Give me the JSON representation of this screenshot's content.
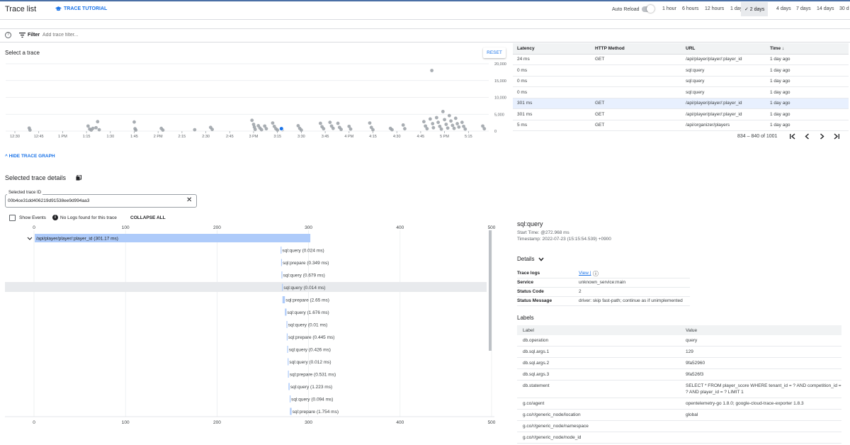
{
  "header": {
    "title": "Trace list",
    "tutorial_label": "TRACE TUTORIAL",
    "auto_reload_label": "Auto Reload",
    "time_ranges": [
      "1 hour",
      "6 hours",
      "12 hours",
      "1 day",
      "2 days",
      "4 days",
      "7 days",
      "14 days",
      "30 d"
    ],
    "selected_range": "2 days"
  },
  "filter": {
    "label": "Filter",
    "placeholder": "Add trace filter..."
  },
  "scatter": {
    "title": "Select a trace",
    "reset_label": "RESET"
  },
  "chart_data": {
    "type": "scatter",
    "x_ticks": [
      "12:30",
      "12:45",
      "1 PM",
      "1:15",
      "1:30",
      "1:45",
      "2 PM",
      "2:15",
      "2:30",
      "2:45",
      "3 PM",
      "3:15",
      "3:30",
      "3:45",
      "4 PM",
      "4:15",
      "4:30",
      "4:45",
      "5 PM",
      "5:15"
    ],
    "y_ticks": [
      "0",
      "5,000",
      "10,000",
      "15,000",
      "20,000"
    ],
    "ylim": [
      0,
      20000
    ],
    "x_start_label": "12:30",
    "minutes_per_tick": 15,
    "points": [
      {
        "t": 9,
        "y": 900
      },
      {
        "t": 9.5,
        "y": 300
      },
      {
        "t": 46,
        "y": 1500
      },
      {
        "t": 47,
        "y": 600
      },
      {
        "t": 48,
        "y": 300
      },
      {
        "t": 49,
        "y": 800
      },
      {
        "t": 52,
        "y": 2800
      },
      {
        "t": 53,
        "y": 400
      },
      {
        "t": 51,
        "y": 1000
      },
      {
        "t": 75,
        "y": 2700
      },
      {
        "t": 75.5,
        "y": 700
      },
      {
        "t": 76,
        "y": 300
      },
      {
        "t": 92,
        "y": 800
      },
      {
        "t": 93,
        "y": 300
      },
      {
        "t": 113,
        "y": 400
      },
      {
        "t": 123,
        "y": 1100
      },
      {
        "t": 124,
        "y": 500
      },
      {
        "t": 149,
        "y": 3200
      },
      {
        "t": 150,
        "y": 2000
      },
      {
        "t": 150.5,
        "y": 1200
      },
      {
        "t": 151,
        "y": 500
      },
      {
        "t": 153,
        "y": 1600
      },
      {
        "t": 154,
        "y": 900
      },
      {
        "t": 155,
        "y": 400
      },
      {
        "t": 157,
        "y": 1500
      },
      {
        "t": 158,
        "y": 700
      },
      {
        "t": 162,
        "y": 2400
      },
      {
        "t": 163,
        "y": 1400
      },
      {
        "t": 164,
        "y": 700
      },
      {
        "t": 165,
        "y": 300
      },
      {
        "t": 168,
        "y": 400
      },
      {
        "t": 178,
        "y": 1600
      },
      {
        "t": 179,
        "y": 800
      },
      {
        "t": 180,
        "y": 300
      },
      {
        "t": 192,
        "y": 2300
      },
      {
        "t": 193,
        "y": 1300
      },
      {
        "t": 194,
        "y": 700
      },
      {
        "t": 198,
        "y": 2600
      },
      {
        "t": 199,
        "y": 1500
      },
      {
        "t": 200,
        "y": 800
      },
      {
        "t": 203,
        "y": 2300
      },
      {
        "t": 204,
        "y": 1100
      },
      {
        "t": 205,
        "y": 500
      },
      {
        "t": 210,
        "y": 1400
      },
      {
        "t": 211,
        "y": 600
      },
      {
        "t": 223,
        "y": 2400
      },
      {
        "t": 224,
        "y": 1100
      },
      {
        "t": 225,
        "y": 400
      },
      {
        "t": 236,
        "y": 800
      },
      {
        "t": 237,
        "y": 400
      },
      {
        "t": 244,
        "y": 1800
      },
      {
        "t": 245,
        "y": 700
      },
      {
        "t": 262,
        "y": 18000
      },
      {
        "t": 257,
        "y": 2800
      },
      {
        "t": 258,
        "y": 1500
      },
      {
        "t": 259,
        "y": 700
      },
      {
        "t": 261,
        "y": 3600
      },
      {
        "t": 262.5,
        "y": 2200
      },
      {
        "t": 263,
        "y": 1000
      },
      {
        "t": 265,
        "y": 4000
      },
      {
        "t": 266,
        "y": 2600
      },
      {
        "t": 267,
        "y": 1400
      },
      {
        "t": 268,
        "y": 600
      },
      {
        "t": 269,
        "y": 5800
      },
      {
        "t": 270,
        "y": 3400
      },
      {
        "t": 271,
        "y": 2000
      },
      {
        "t": 272,
        "y": 900
      },
      {
        "t": 273,
        "y": 4600
      },
      {
        "t": 274,
        "y": 3000
      },
      {
        "t": 275,
        "y": 1700
      },
      {
        "t": 276,
        "y": 800
      },
      {
        "t": 277,
        "y": 3800
      },
      {
        "t": 278,
        "y": 2200
      },
      {
        "t": 279,
        "y": 1200
      },
      {
        "t": 281,
        "y": 2600
      },
      {
        "t": 282,
        "y": 1400
      },
      {
        "t": 283,
        "y": 600
      },
      {
        "t": 294,
        "y": 1500
      },
      {
        "t": 295,
        "y": 700
      }
    ],
    "selected_point": {
      "t": 167.5,
      "y": 301
    }
  },
  "trace_table": {
    "columns": [
      "Latency",
      "HTTP Method",
      "URL",
      "Time"
    ],
    "rows": [
      [
        "24 ms",
        "GET",
        "/api/player/player/:player_id",
        "1 day ago"
      ],
      [
        "0 ms",
        "",
        "sql:query",
        "1 day ago"
      ],
      [
        "0 ms",
        "",
        "sql:query",
        "1 day ago"
      ],
      [
        "0 ms",
        "",
        "sql:query",
        "1 day ago"
      ],
      [
        "301 ms",
        "GET",
        "/api/player/player/:player_id",
        "1 day ago"
      ],
      [
        "301 ms",
        "GET",
        "/api/player/player/:player_id",
        "1 day ago"
      ],
      [
        "5 ms",
        "GET",
        "/api/organizer/players",
        "1 day ago"
      ]
    ],
    "selected_row": 4,
    "sort_arrow": "↓",
    "pager_text": "834 – 840 of 1001"
  },
  "graph": {
    "hide_label": "HIDE TRACE GRAPH"
  },
  "details": {
    "title": "Selected trace details",
    "trace_id_label": "Selected trace ID",
    "trace_id": "00b4ce31dd406219d91538ee9d994aa3",
    "show_events_label": "Show Events",
    "no_logs_label": "No Logs found for this trace",
    "collapse_all_label": "COLLAPSE ALL"
  },
  "waterfall": {
    "axis_max": 500,
    "ticks": [
      "0",
      "100",
      "200",
      "300",
      "400",
      "500"
    ],
    "root": {
      "label": "/api/player/player/:player_id (301.17 ms)",
      "start": 0,
      "duration": 301.17
    },
    "spans": [
      {
        "label": "sql:query (0.024 ms)",
        "start": 269.5,
        "duration": 0.3
      },
      {
        "label": "sql:prepare (0.349 ms)",
        "start": 270.0,
        "duration": 0.5
      },
      {
        "label": "sql:query (0.679 ms)",
        "start": 270.4,
        "duration": 0.7
      },
      {
        "label": "sql:query (0.014 ms)",
        "start": 271.0,
        "duration": 0.3
      },
      {
        "label": "sql:prepare (2.65 ms)",
        "start": 271.5,
        "duration": 2.65
      },
      {
        "label": "sql:query (1.676 ms)",
        "start": 274.2,
        "duration": 1.68
      },
      {
        "label": "sql:query (0.01 ms)",
        "start": 275.9,
        "duration": 0.3
      },
      {
        "label": "sql:prepare (0.445 ms)",
        "start": 276.2,
        "duration": 0.5
      },
      {
        "label": "sql:query (0.426 ms)",
        "start": 276.7,
        "duration": 0.5
      },
      {
        "label": "sql:query (0.012 ms)",
        "start": 277.2,
        "duration": 0.3
      },
      {
        "label": "sql:prepare (0.531 ms)",
        "start": 277.5,
        "duration": 0.53
      },
      {
        "label": "sql:query (1.223 ms)",
        "start": 278.1,
        "duration": 1.22
      },
      {
        "label": "sql:query (0.094 ms)",
        "start": 279.4,
        "duration": 0.3
      },
      {
        "label": "sql:prepare (1.754 ms)",
        "start": 279.7,
        "duration": 1.75
      }
    ],
    "highlighted_span": 3
  },
  "span_detail": {
    "name": "sql:query",
    "start_time": "Start Time: @272.968 ms",
    "timestamp": "Timestamp: 2022-07-23 (15:15:54.539) +0900",
    "details_label": "Details",
    "fields": [
      {
        "key": "Trace logs",
        "value": "View |"
      },
      {
        "key": "Service",
        "value": "unknown_service:main"
      },
      {
        "key": "Status Code",
        "value": "2"
      },
      {
        "key": "Status Message",
        "value": "driver: skip fast-path; continue as if unimplemented"
      }
    ],
    "labels_title": "Labels",
    "labels_columns": [
      "Label",
      "Value"
    ],
    "labels": [
      [
        "db.operation",
        "query"
      ],
      [
        "db.sql.args.1",
        "129"
      ],
      [
        "db.sql.args.2",
        "9fa52960"
      ],
      [
        "db.sql.args.3",
        "9fa526f3"
      ],
      [
        "db.statement",
        "SELECT * FROM player_score WHERE tenant_id = ? AND competition_id = ? AND player_id = ? LIMIT 1"
      ],
      [
        "g.co/agent",
        "opentelemetry-go 1.8.0; google-cloud-trace-exporter 1.8.3"
      ],
      [
        "g.co/r/generic_node/location",
        "global"
      ],
      [
        "g.co/r/generic_node/namespace",
        ""
      ],
      [
        "g.co/r/generic_node/node_id",
        ""
      ]
    ]
  },
  "colors": {
    "accent": "#1a73e8",
    "span_bar": "#aecbfa",
    "point": "#9aa0a6"
  }
}
